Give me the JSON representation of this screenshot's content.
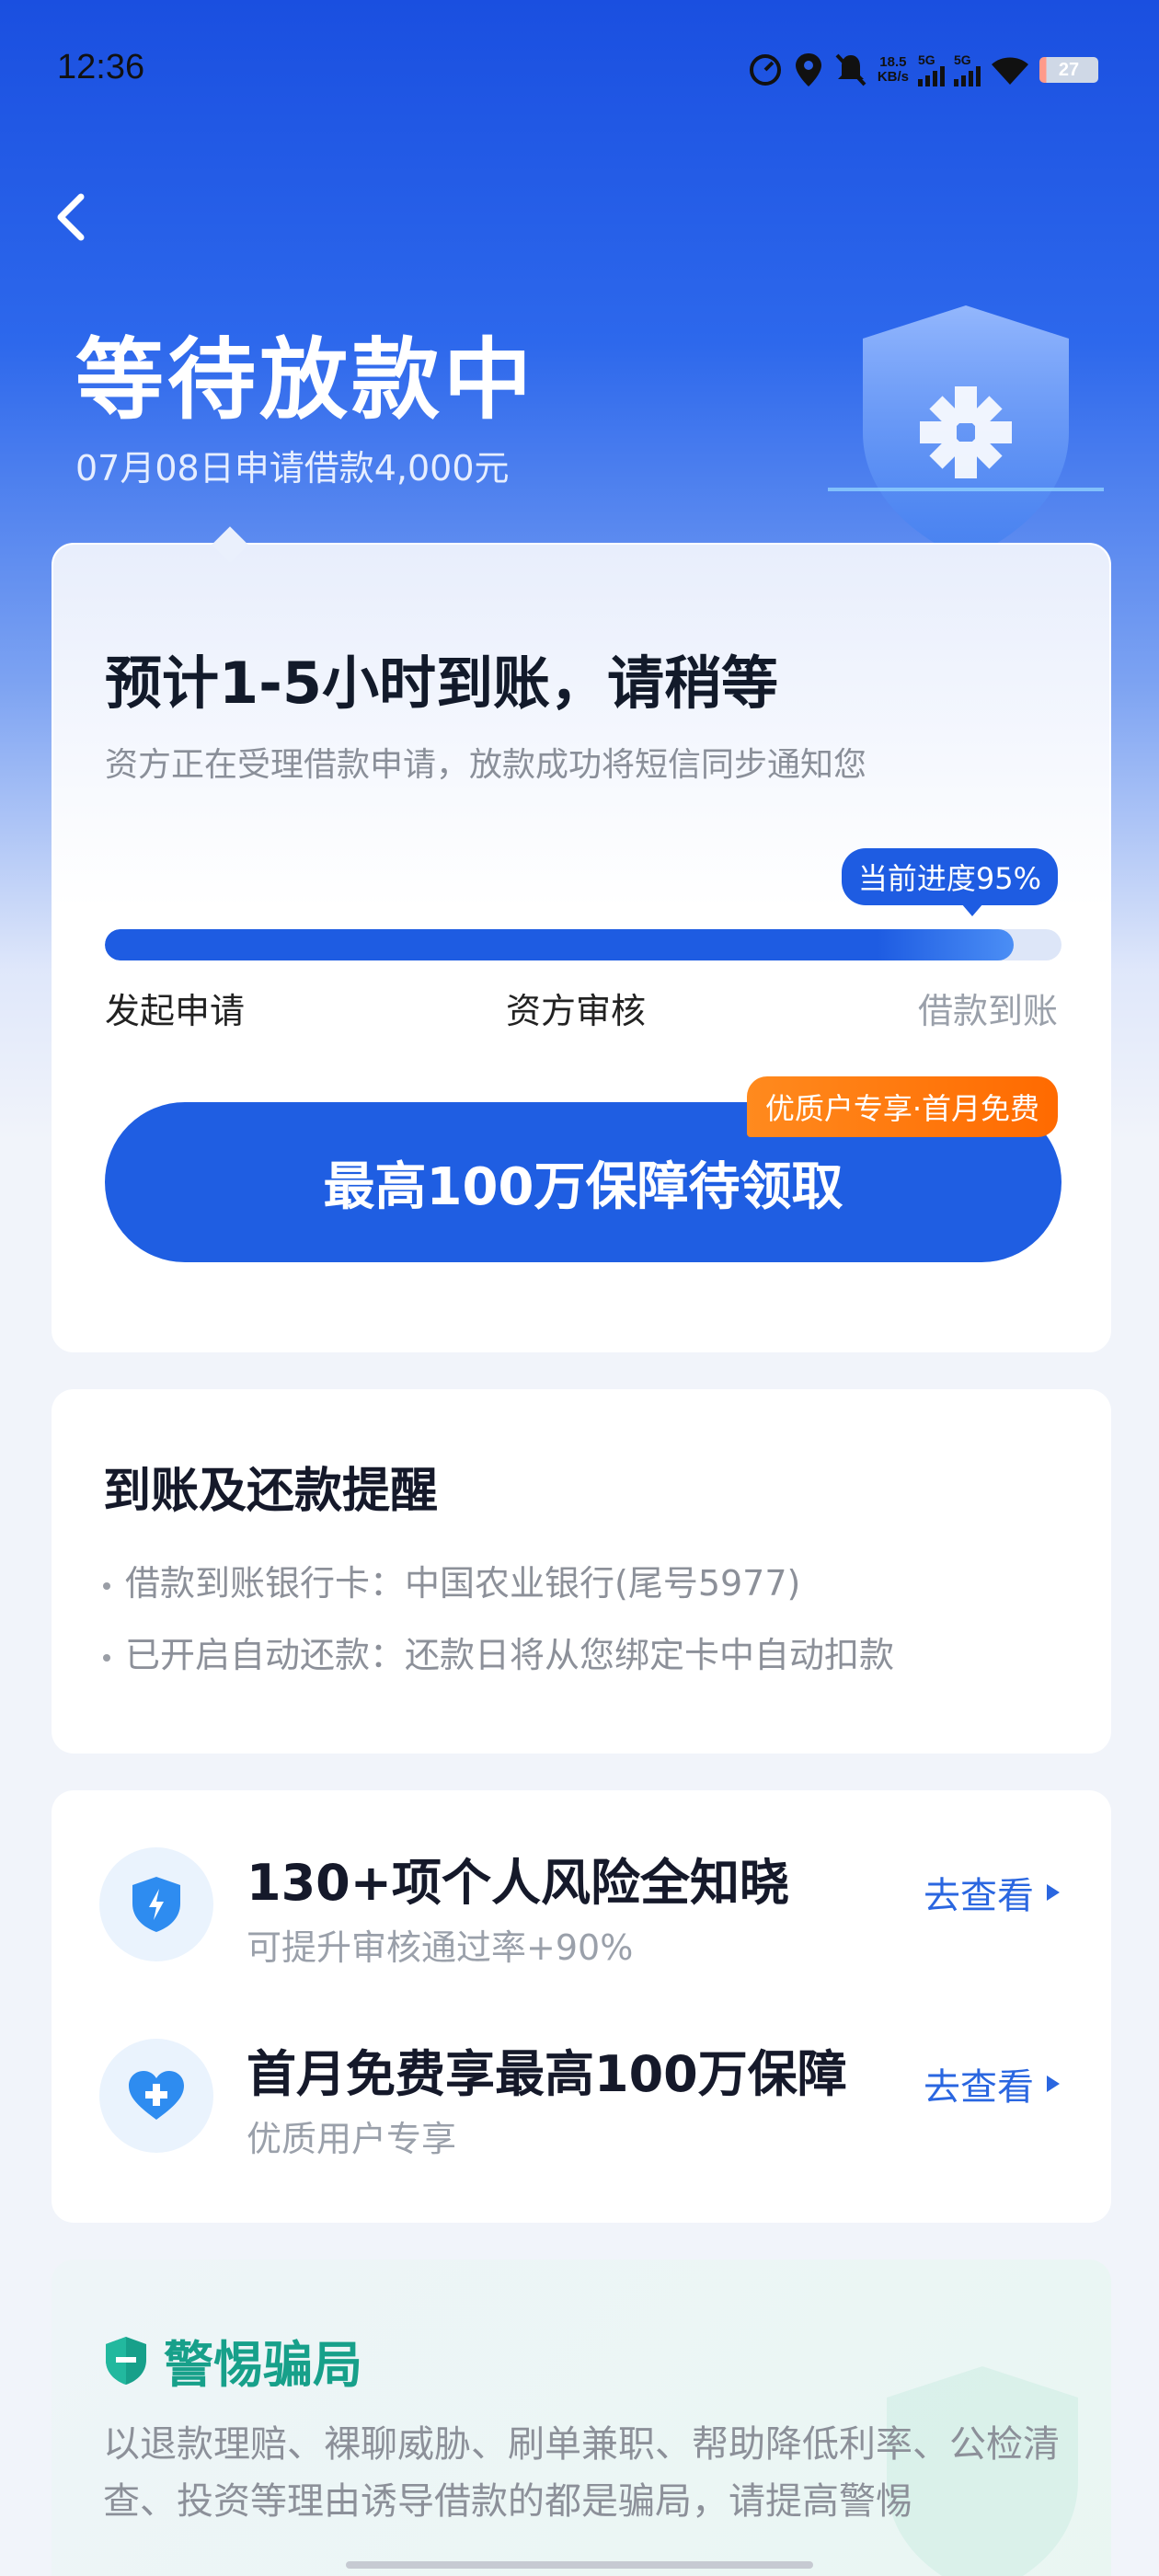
{
  "status_bar": {
    "time": "12:36",
    "net_speed_value": "18.5",
    "net_speed_unit": "KB/s",
    "sim1": "5G",
    "sim2": "5G",
    "battery": "27"
  },
  "header": {
    "title": "等待放款中",
    "subtitle": "07月08日申请借款4,000元"
  },
  "main_card": {
    "headline": "预计1-5小时到账，请稍等",
    "description": "资方正在受理借款申请，放款成功将短信同步通知您",
    "progress_label": "当前进度95%",
    "progress_percent": 95,
    "steps": [
      "发起申请",
      "资方审核",
      "借款到账"
    ],
    "cta_label": "最高100万保障待领取",
    "cta_tag": "优质户专享·首月免费"
  },
  "reminder": {
    "title": "到账及还款提醒",
    "lines": [
      "借款到账银行卡：中国农业银行(尾号5977)",
      "已开启自动还款：还款日将从您绑定卡中自动扣款"
    ]
  },
  "offers": [
    {
      "title": "130+项个人风险全知晓",
      "subtitle": "可提升审核通过率+90%",
      "link": "去查看",
      "icon": "shield-bolt-icon"
    },
    {
      "title": "首月免费享最高100万保障",
      "subtitle": "优质用户专享",
      "link": "去查看",
      "icon": "heart-plus-icon"
    }
  ],
  "warning": {
    "title": "警惕骗局",
    "text": "以退款理赔、裸聊威胁、刷单兼职、帮助降低利率、公检清查、投资等理由诱导借款的都是骗局，请提高警惕"
  },
  "colors": {
    "primary": "#1f5ee2",
    "orange_tag": "#ff7a10",
    "warn_green": "#17a08a"
  }
}
